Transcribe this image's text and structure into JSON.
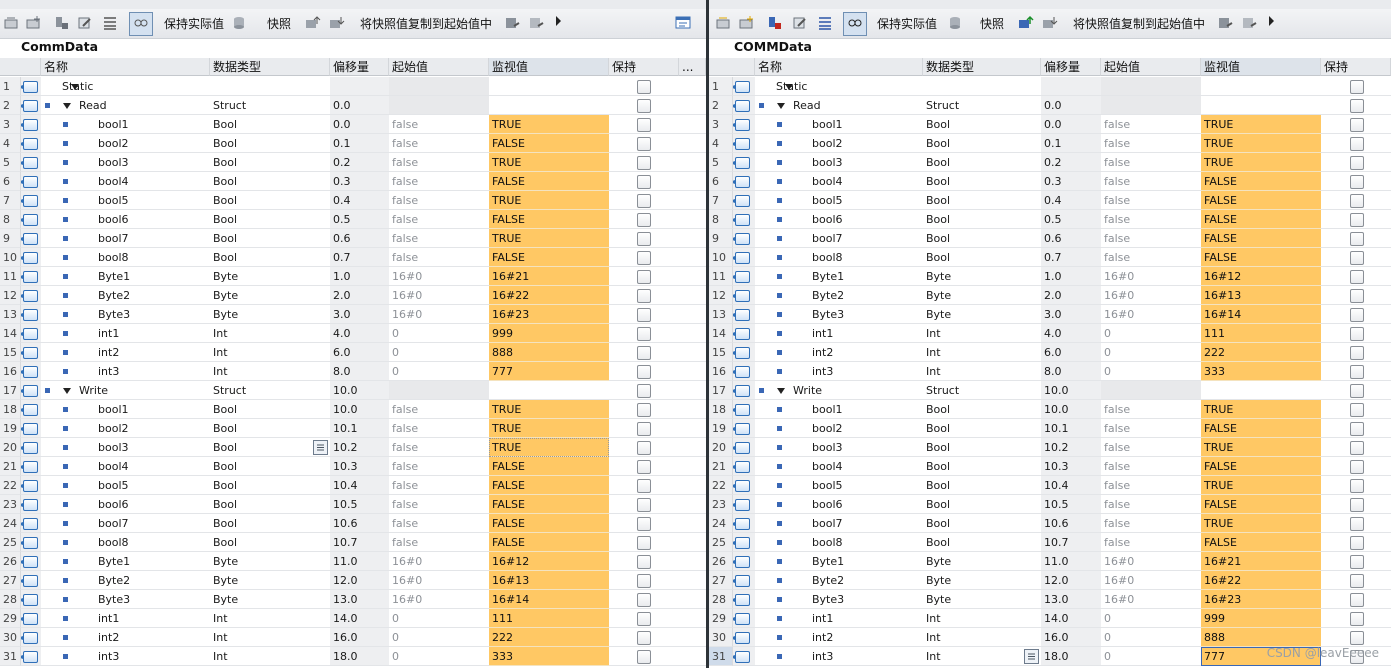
{
  "left": {
    "toolbar": {
      "keep_actual": "保持实际值",
      "snapshot": "快照",
      "copy_snapshot": "将快照值复制到起始值中"
    },
    "title": "CommData",
    "headers": {
      "name": "名称",
      "type": "数据类型",
      "offset": "偏移量",
      "start": "起始值",
      "monitor": "监视值",
      "retain": "保持",
      "more": "..."
    },
    "rows": [
      {
        "n": "1",
        "name": "Static",
        "type": "",
        "offset": "",
        "start": "",
        "mon": "",
        "level": 0,
        "kind": "section"
      },
      {
        "n": "2",
        "name": "Read",
        "type": "Struct",
        "offset": "0.0",
        "start": "",
        "mon": "",
        "level": 1,
        "kind": "struct"
      },
      {
        "n": "3",
        "name": "bool1",
        "type": "Bool",
        "offset": "0.0",
        "start": "false",
        "mon": "TRUE",
        "level": 2
      },
      {
        "n": "4",
        "name": "bool2",
        "type": "Bool",
        "offset": "0.1",
        "start": "false",
        "mon": "FALSE",
        "level": 2
      },
      {
        "n": "5",
        "name": "bool3",
        "type": "Bool",
        "offset": "0.2",
        "start": "false",
        "mon": "TRUE",
        "level": 2
      },
      {
        "n": "6",
        "name": "bool4",
        "type": "Bool",
        "offset": "0.3",
        "start": "false",
        "mon": "FALSE",
        "level": 2
      },
      {
        "n": "7",
        "name": "bool5",
        "type": "Bool",
        "offset": "0.4",
        "start": "false",
        "mon": "TRUE",
        "level": 2
      },
      {
        "n": "8",
        "name": "bool6",
        "type": "Bool",
        "offset": "0.5",
        "start": "false",
        "mon": "FALSE",
        "level": 2
      },
      {
        "n": "9",
        "name": "bool7",
        "type": "Bool",
        "offset": "0.6",
        "start": "false",
        "mon": "TRUE",
        "level": 2
      },
      {
        "n": "10",
        "name": "bool8",
        "type": "Bool",
        "offset": "0.7",
        "start": "false",
        "mon": "FALSE",
        "level": 2
      },
      {
        "n": "11",
        "name": "Byte1",
        "type": "Byte",
        "offset": "1.0",
        "start": "16#0",
        "mon": "16#21",
        "level": 2
      },
      {
        "n": "12",
        "name": "Byte2",
        "type": "Byte",
        "offset": "2.0",
        "start": "16#0",
        "mon": "16#22",
        "level": 2
      },
      {
        "n": "13",
        "name": "Byte3",
        "type": "Byte",
        "offset": "3.0",
        "start": "16#0",
        "mon": "16#23",
        "level": 2
      },
      {
        "n": "14",
        "name": "int1",
        "type": "Int",
        "offset": "4.0",
        "start": "0",
        "mon": "999",
        "level": 2
      },
      {
        "n": "15",
        "name": "int2",
        "type": "Int",
        "offset": "6.0",
        "start": "0",
        "mon": "888",
        "level": 2
      },
      {
        "n": "16",
        "name": "int3",
        "type": "Int",
        "offset": "8.0",
        "start": "0",
        "mon": "777",
        "level": 2
      },
      {
        "n": "17",
        "name": "Write",
        "type": "Struct",
        "offset": "10.0",
        "start": "",
        "mon": "",
        "level": 1,
        "kind": "struct"
      },
      {
        "n": "18",
        "name": "bool1",
        "type": "Bool",
        "offset": "10.0",
        "start": "false",
        "mon": "TRUE",
        "level": 2
      },
      {
        "n": "19",
        "name": "bool2",
        "type": "Bool",
        "offset": "10.1",
        "start": "false",
        "mon": "TRUE",
        "level": 2
      },
      {
        "n": "20",
        "name": "bool3",
        "type": "Bool",
        "offset": "10.2",
        "start": "false",
        "mon": "TRUE",
        "level": 2,
        "editIcon": true
      },
      {
        "n": "21",
        "name": "bool4",
        "type": "Bool",
        "offset": "10.3",
        "start": "false",
        "mon": "FALSE",
        "level": 2
      },
      {
        "n": "22",
        "name": "bool5",
        "type": "Bool",
        "offset": "10.4",
        "start": "false",
        "mon": "FALSE",
        "level": 2
      },
      {
        "n": "23",
        "name": "bool6",
        "type": "Bool",
        "offset": "10.5",
        "start": "false",
        "mon": "FALSE",
        "level": 2
      },
      {
        "n": "24",
        "name": "bool7",
        "type": "Bool",
        "offset": "10.6",
        "start": "false",
        "mon": "FALSE",
        "level": 2
      },
      {
        "n": "25",
        "name": "bool8",
        "type": "Bool",
        "offset": "10.7",
        "start": "false",
        "mon": "FALSE",
        "level": 2
      },
      {
        "n": "26",
        "name": "Byte1",
        "type": "Byte",
        "offset": "11.0",
        "start": "16#0",
        "mon": "16#12",
        "level": 2
      },
      {
        "n": "27",
        "name": "Byte2",
        "type": "Byte",
        "offset": "12.0",
        "start": "16#0",
        "mon": "16#13",
        "level": 2
      },
      {
        "n": "28",
        "name": "Byte3",
        "type": "Byte",
        "offset": "13.0",
        "start": "16#0",
        "mon": "16#14",
        "level": 2
      },
      {
        "n": "29",
        "name": "int1",
        "type": "Int",
        "offset": "14.0",
        "start": "0",
        "mon": "111",
        "level": 2
      },
      {
        "n": "30",
        "name": "int2",
        "type": "Int",
        "offset": "16.0",
        "start": "0",
        "mon": "222",
        "level": 2
      },
      {
        "n": "31",
        "name": "int3",
        "type": "Int",
        "offset": "18.0",
        "start": "0",
        "mon": "333",
        "level": 2
      }
    ]
  },
  "right": {
    "toolbar": {
      "keep_actual": "保持实际值",
      "snapshot": "快照",
      "copy_snapshot": "将快照值复制到起始值中"
    },
    "title": "COMMData",
    "headers": {
      "name": "名称",
      "type": "数据类型",
      "offset": "偏移量",
      "start": "起始值",
      "monitor": "监视值",
      "retain": "保持"
    },
    "rows": [
      {
        "n": "1",
        "name": "Static",
        "type": "",
        "offset": "",
        "start": "",
        "mon": "",
        "level": 0,
        "kind": "section"
      },
      {
        "n": "2",
        "name": "Read",
        "type": "Struct",
        "offset": "0.0",
        "start": "",
        "mon": "",
        "level": 1,
        "kind": "struct"
      },
      {
        "n": "3",
        "name": "bool1",
        "type": "Bool",
        "offset": "0.0",
        "start": "false",
        "mon": "TRUE",
        "level": 2
      },
      {
        "n": "4",
        "name": "bool2",
        "type": "Bool",
        "offset": "0.1",
        "start": "false",
        "mon": "TRUE",
        "level": 2
      },
      {
        "n": "5",
        "name": "bool3",
        "type": "Bool",
        "offset": "0.2",
        "start": "false",
        "mon": "TRUE",
        "level": 2
      },
      {
        "n": "6",
        "name": "bool4",
        "type": "Bool",
        "offset": "0.3",
        "start": "false",
        "mon": "FALSE",
        "level": 2
      },
      {
        "n": "7",
        "name": "bool5",
        "type": "Bool",
        "offset": "0.4",
        "start": "false",
        "mon": "FALSE",
        "level": 2
      },
      {
        "n": "8",
        "name": "bool6",
        "type": "Bool",
        "offset": "0.5",
        "start": "false",
        "mon": "FALSE",
        "level": 2
      },
      {
        "n": "9",
        "name": "bool7",
        "type": "Bool",
        "offset": "0.6",
        "start": "false",
        "mon": "FALSE",
        "level": 2
      },
      {
        "n": "10",
        "name": "bool8",
        "type": "Bool",
        "offset": "0.7",
        "start": "false",
        "mon": "FALSE",
        "level": 2
      },
      {
        "n": "11",
        "name": "Byte1",
        "type": "Byte",
        "offset": "1.0",
        "start": "16#0",
        "mon": "16#12",
        "level": 2
      },
      {
        "n": "12",
        "name": "Byte2",
        "type": "Byte",
        "offset": "2.0",
        "start": "16#0",
        "mon": "16#13",
        "level": 2
      },
      {
        "n": "13",
        "name": "Byte3",
        "type": "Byte",
        "offset": "3.0",
        "start": "16#0",
        "mon": "16#14",
        "level": 2
      },
      {
        "n": "14",
        "name": "int1",
        "type": "Int",
        "offset": "4.0",
        "start": "0",
        "mon": "111",
        "level": 2
      },
      {
        "n": "15",
        "name": "int2",
        "type": "Int",
        "offset": "6.0",
        "start": "0",
        "mon": "222",
        "level": 2
      },
      {
        "n": "16",
        "name": "int3",
        "type": "Int",
        "offset": "8.0",
        "start": "0",
        "mon": "333",
        "level": 2
      },
      {
        "n": "17",
        "name": "Write",
        "type": "Struct",
        "offset": "10.0",
        "start": "",
        "mon": "",
        "level": 1,
        "kind": "struct"
      },
      {
        "n": "18",
        "name": "bool1",
        "type": "Bool",
        "offset": "10.0",
        "start": "false",
        "mon": "TRUE",
        "level": 2
      },
      {
        "n": "19",
        "name": "bool2",
        "type": "Bool",
        "offset": "10.1",
        "start": "false",
        "mon": "FALSE",
        "level": 2
      },
      {
        "n": "20",
        "name": "bool3",
        "type": "Bool",
        "offset": "10.2",
        "start": "false",
        "mon": "TRUE",
        "level": 2
      },
      {
        "n": "21",
        "name": "bool4",
        "type": "Bool",
        "offset": "10.3",
        "start": "false",
        "mon": "FALSE",
        "level": 2
      },
      {
        "n": "22",
        "name": "bool5",
        "type": "Bool",
        "offset": "10.4",
        "start": "false",
        "mon": "TRUE",
        "level": 2
      },
      {
        "n": "23",
        "name": "bool6",
        "type": "Bool",
        "offset": "10.5",
        "start": "false",
        "mon": "FALSE",
        "level": 2
      },
      {
        "n": "24",
        "name": "bool7",
        "type": "Bool",
        "offset": "10.6",
        "start": "false",
        "mon": "TRUE",
        "level": 2
      },
      {
        "n": "25",
        "name": "bool8",
        "type": "Bool",
        "offset": "10.7",
        "start": "false",
        "mon": "FALSE",
        "level": 2
      },
      {
        "n": "26",
        "name": "Byte1",
        "type": "Byte",
        "offset": "11.0",
        "start": "16#0",
        "mon": "16#21",
        "level": 2
      },
      {
        "n": "27",
        "name": "Byte2",
        "type": "Byte",
        "offset": "12.0",
        "start": "16#0",
        "mon": "16#22",
        "level": 2
      },
      {
        "n": "28",
        "name": "Byte3",
        "type": "Byte",
        "offset": "13.0",
        "start": "16#0",
        "mon": "16#23",
        "level": 2
      },
      {
        "n": "29",
        "name": "int1",
        "type": "Int",
        "offset": "14.0",
        "start": "0",
        "mon": "999",
        "level": 2
      },
      {
        "n": "30",
        "name": "int2",
        "type": "Int",
        "offset": "16.0",
        "start": "0",
        "mon": "888",
        "level": 2
      },
      {
        "n": "31",
        "name": "int3",
        "type": "Int",
        "offset": "18.0",
        "start": "0",
        "mon": "777",
        "level": 2,
        "editIcon": true
      }
    ]
  },
  "watermark": "CSDN @leavEeeee",
  "colors": {
    "monitor_bg": "#ffc864",
    "divider": "#2d3338",
    "accent": "#2f6fb8"
  }
}
